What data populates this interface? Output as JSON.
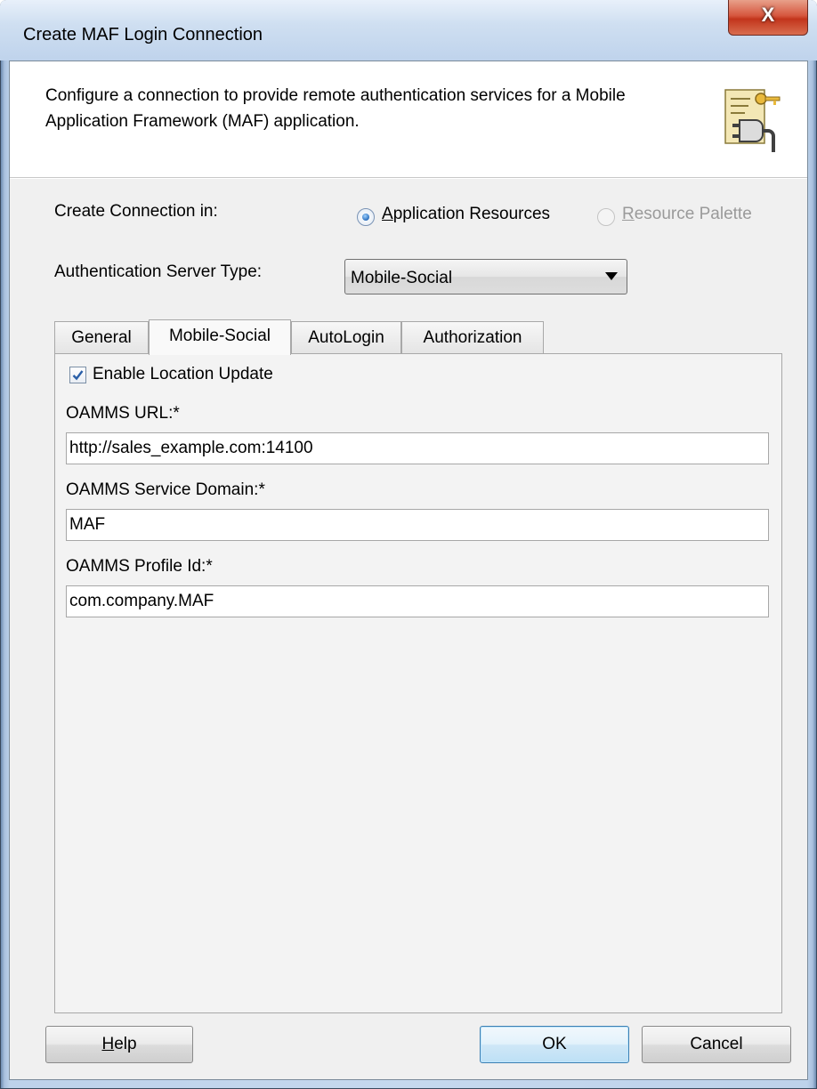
{
  "window": {
    "title": "Create MAF Login Connection",
    "close_glyph": "X"
  },
  "header": {
    "description": "Configure a connection to provide remote authentication services for a Mobile Application Framework (MAF) application.",
    "icon": "connection-key-icon"
  },
  "create_connection": {
    "label": "Create Connection in:",
    "options": [
      {
        "label": "Application Resources",
        "selected": true,
        "enabled": true
      },
      {
        "label": "Resource Palette",
        "selected": false,
        "enabled": false
      }
    ]
  },
  "server_type": {
    "label": "Authentication Server Type:",
    "value": "Mobile-Social"
  },
  "tabs": [
    {
      "label": "General",
      "selected": false
    },
    {
      "label": "Mobile-Social",
      "selected": true
    },
    {
      "label": "AutoLogin",
      "selected": false
    },
    {
      "label": "Authorization",
      "selected": false
    }
  ],
  "mobile_social": {
    "enable_location": {
      "label": "Enable Location Update",
      "checked": true
    },
    "url": {
      "label": "OAMMS URL:*",
      "value": "http://sales_example.com:14100"
    },
    "service_domain": {
      "label": "OAMMS Service Domain:*",
      "value": "MAF"
    },
    "profile_id": {
      "label": "OAMMS Profile Id:*",
      "value": "com.company.MAF"
    }
  },
  "buttons": {
    "help": "Help",
    "ok": "OK",
    "cancel": "Cancel"
  },
  "colors": {
    "title_bar": "#bfd3ec",
    "close_button": "#c2351c",
    "client_bg": "#f0f0f0",
    "default_button_border": "#3c7fb1"
  }
}
